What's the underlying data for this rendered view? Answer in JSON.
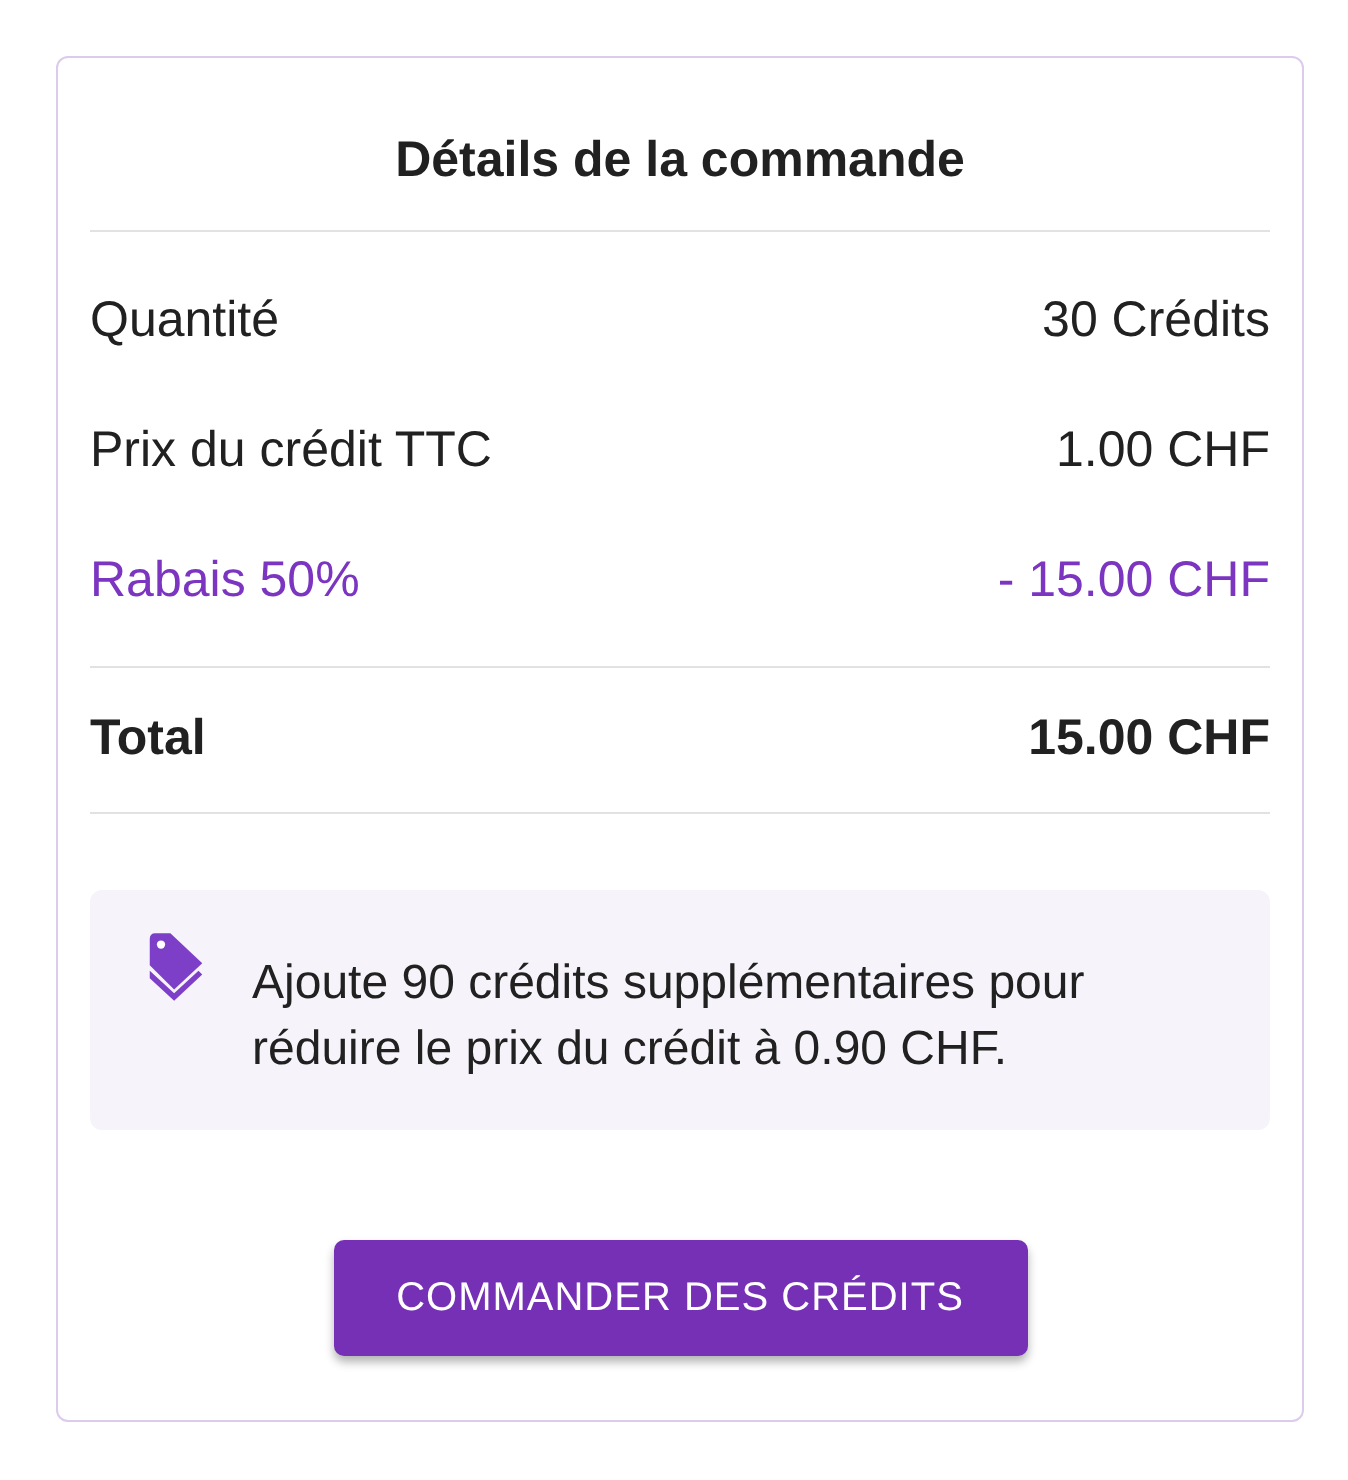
{
  "card": {
    "title": "Détails de la commande"
  },
  "rows": [
    {
      "kind": "item",
      "label": "Quantité",
      "value": "30 Crédits"
    },
    {
      "kind": "item",
      "label": "Prix du crédit TTC",
      "value": "1.00 CHF"
    },
    {
      "kind": "discount",
      "label": "Rabais 50%",
      "value": "- 15.00 CHF"
    }
  ],
  "total": {
    "label": "Total",
    "value": "15.00 CHF"
  },
  "tip": {
    "text": "Ajoute 90 crédits supplémentaires pour réduire le prix du crédit à 0.90 CHF."
  },
  "button": {
    "label": "COMMANDER DES CRÉDITS"
  }
}
